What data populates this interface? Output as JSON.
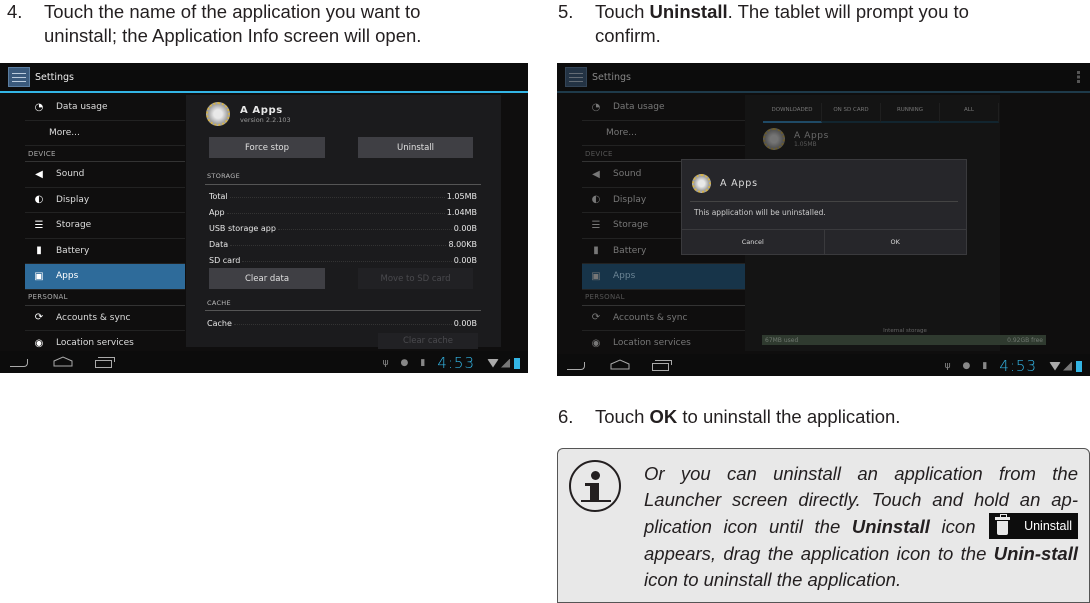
{
  "steps": [
    {
      "num": "4.",
      "line1": "Touch the name of the application you want to",
      "line2": "uninstall; the Application Info screen will open."
    },
    {
      "num": "5.",
      "pre": "Touch ",
      "bold": "Uninstall",
      "post": ". The tablet will prompt you to",
      "line2": "confirm."
    },
    {
      "num": "6.",
      "pre": "Touch ",
      "bold": "OK",
      "post": " to uninstall the application."
    }
  ],
  "screen1": {
    "actionbar_title": "Settings",
    "sidebar": {
      "items": [
        {
          "label": "Data usage",
          "icon": "data-usage-icon"
        },
        {
          "label": "More...",
          "icon": ""
        },
        {
          "header": "DEVICE"
        },
        {
          "label": "Sound",
          "icon": "sound-icon"
        },
        {
          "label": "Display",
          "icon": "display-icon"
        },
        {
          "label": "Storage",
          "icon": "storage-icon"
        },
        {
          "label": "Battery",
          "icon": "battery-icon"
        },
        {
          "label": "Apps",
          "icon": "apps-icon",
          "active": true
        },
        {
          "header": "PERSONAL"
        },
        {
          "label": "Accounts & sync",
          "icon": "sync-icon"
        },
        {
          "label": "Location services",
          "icon": "location-icon"
        }
      ]
    },
    "app": {
      "name": "A Apps",
      "version": "version 2.2.103"
    },
    "buttons": {
      "force_stop": "Force stop",
      "uninstall": "Uninstall",
      "clear_data": "Clear data",
      "move_to_sd": "Move to SD card",
      "clear_cache": "Clear cache"
    },
    "storage_header": "STORAGE",
    "storage_rows": [
      {
        "label": "Total",
        "value": "1.05MB"
      },
      {
        "label": "App",
        "value": "1.04MB"
      },
      {
        "label": "USB storage app",
        "value": "0.00B"
      },
      {
        "label": "Data",
        "value": "8.00KB"
      },
      {
        "label": "SD card",
        "value": "0.00B"
      }
    ],
    "cache_header": "CACHE",
    "cache_row": {
      "label": "Cache",
      "value": "0.00B"
    },
    "status": {
      "clock": "4:53"
    }
  },
  "screen2": {
    "actionbar_title": "Settings",
    "tabs": [
      "DOWNLOADED",
      "ON SD CARD",
      "RUNNING",
      "ALL"
    ],
    "list_app": {
      "name": "A Apps",
      "size": "1.05MB"
    },
    "dialog": {
      "title": "A Apps",
      "message": "This application will be uninstalled.",
      "cancel": "Cancel",
      "ok": "OK"
    },
    "storage": {
      "label": "Internal storage",
      "used": "67MB used",
      "free": "0.92GB free"
    },
    "status": {
      "clock": "4:53"
    }
  },
  "note": {
    "t1": "Or you can uninstall an application from the Launcher screen directly. Touch and hold an ap-plication icon until the ",
    "b1": "Uninstall",
    "t2": " icon ",
    "chip": "Uninstall",
    "t3": " appears, drag the application icon to the ",
    "b2": "Unin-stall",
    "t4": " icon to uninstall the application."
  }
}
